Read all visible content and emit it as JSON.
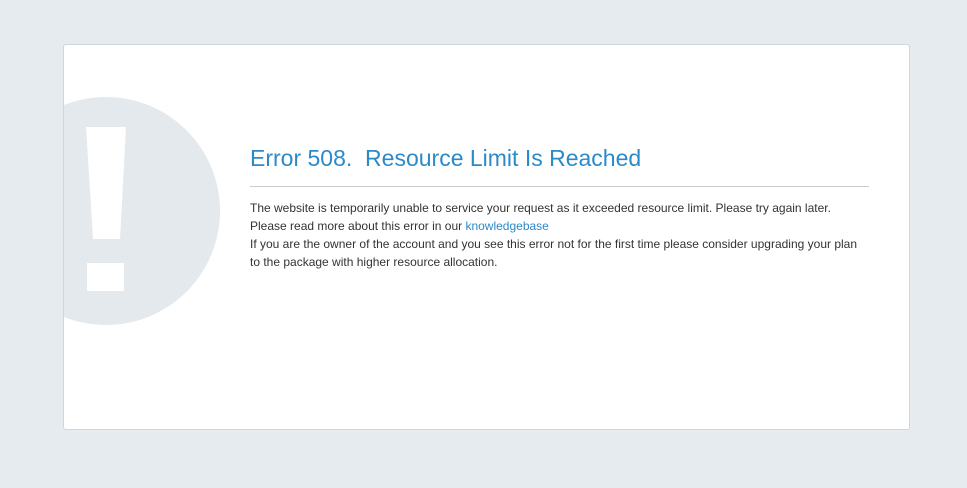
{
  "error": {
    "title": "Error 508.  Resource Limit Is Reached",
    "line1": "The website is temporarily unable to service your request as it exceeded resource limit. Please try again later.",
    "line2_prefix": "Please read more about this error in our ",
    "link_label": "knowledgebase",
    "line3": "If you are the owner of the account and you see this error not for the first time please consider upgrading your plan to the package with higher resource allocation."
  },
  "colors": {
    "background": "#e6ebef",
    "accent": "#2c8ac9",
    "badge": "#e4e9ed"
  },
  "icons": {
    "badge": "exclamation-icon"
  }
}
